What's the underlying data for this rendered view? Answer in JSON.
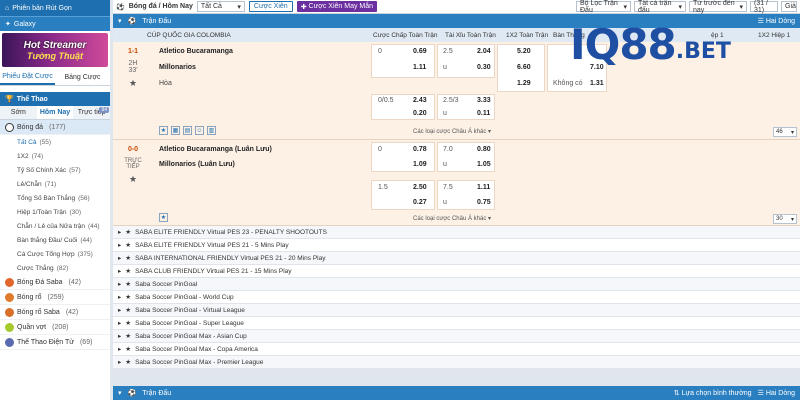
{
  "sidebar": {
    "top_label": "Phiên bản Rút Gọn",
    "galaxy_label": "Galaxy",
    "banner_line1": "Hot Streamer",
    "banner_line2": "Tường Thuật",
    "tab_betslip": "Phiếu Đặt Cược",
    "tab_board": "Bảng Cược",
    "sport_header": "Thể Thao",
    "time_tabs": [
      {
        "label": "Sớm",
        "active": false
      },
      {
        "label": "Hôm Nay",
        "active": true
      },
      {
        "label": "Trực tiếp",
        "active": false,
        "badge": "94"
      }
    ],
    "football": {
      "label": "Bóng đá",
      "count": "(177)"
    },
    "bet_types": [
      {
        "label": "Tất Cả",
        "count": "(55)",
        "active": true
      },
      {
        "label": "1X2",
        "count": "(74)"
      },
      {
        "label": "Tỷ Số Chính Xác",
        "count": "(57)"
      },
      {
        "label": "Lẻ/Chẵn",
        "count": "(71)"
      },
      {
        "label": "Tổng Số Bàn Thắng",
        "count": "(56)"
      },
      {
        "label": "Hiệp 1/Toàn Trận",
        "count": "(30)"
      },
      {
        "label": "Chẵn / Lẻ của Nửa trận",
        "count": "(44)"
      },
      {
        "label": "Bàn thắng Đầu/ Cuối",
        "count": "(44)"
      },
      {
        "label": "Cá Cược Tổng Hợp",
        "count": "(375)"
      },
      {
        "label": "Cược Thắng",
        "count": "(82)"
      }
    ],
    "sports": [
      {
        "label": "Bóng Đá Saba",
        "count": "(42)",
        "color": "#e0662c"
      },
      {
        "label": "Bóng rổ",
        "count": "(259)",
        "color": "#e07a2c"
      },
      {
        "label": "Bóng rổ Saba",
        "count": "(42)",
        "color": "#d9702a"
      },
      {
        "label": "Quần vợt",
        "count": "(208)",
        "color": "#a6c92c"
      },
      {
        "label": "Thể Thao Điện Tử",
        "count": "(69)",
        "color": "#5a6ab0"
      }
    ]
  },
  "toolbar": {
    "breadcrumb": "Bóng đá / Hôm Nay",
    "filter_all": "Tất Cả",
    "combo_button": "Cược Xiên",
    "lucky_combo_button": "Cược Xiên May Mắn",
    "league_filter": "Bộ Lọc Trận Đấu",
    "all_matches": "Tất cả trận đấu",
    "from_time": "Từ trước đến nay",
    "pages": "(31 / 31)",
    "odds_type": "Giả"
  },
  "section": {
    "title": "Trận Đấu",
    "sort": "Lựa chọn bình thường",
    "view": "Hai Dòng",
    "bottom_title": "Trận Đấu"
  },
  "columns": {
    "league": "CÚP QUỐC GIA COLOMBIA",
    "handicap": "Cược Chấp Toàn Trận",
    "over_under": "Tài Xỉu Toàn Trận",
    "x12": "1X2 Toàn Trận",
    "goals": "Bàn Thắng",
    "h1": "ệp 1",
    "x12_h1": "1X2 Hiệp 1"
  },
  "match1": {
    "score": "1-1",
    "period": "2H",
    "minute": "33'",
    "home": "Atletico Bucaramanga",
    "away": "Millonarios",
    "draw": "Hòa",
    "hdp1": "0",
    "hdp1_odds": "0.69",
    "hdp1_away": "1.11",
    "ou1": "2.5",
    "ou1_odds": "2.04",
    "ou1_u": "u",
    "ou1_u_odds": "0.30",
    "x12_home": "5.20",
    "x12_away": "6.60",
    "x12_draw": "1.29",
    "goal_yes_odds": "7.10",
    "goal_no": "Không có",
    "goal_no_odds": "1.31",
    "hdp2": "0/0.5",
    "hdp2_odds": "2.43",
    "hdp2_away": "0.20",
    "ou2": "2.5/3",
    "ou2_odds": "3.33",
    "ou2_u": "u",
    "ou2_u_odds": "0.11",
    "more": "Các loại cược Châu Á khác",
    "count": "46"
  },
  "match2": {
    "score": "0-0",
    "status1": "TRỰC",
    "status2": "TIẾP",
    "home": "Atletico Bucaramanga (Luân Lưu)",
    "away": "Millonarios (Luân Lưu)",
    "hdp1": "0",
    "hdp1_odds": "0.78",
    "hdp1_away": "1.09",
    "ou1": "7.0",
    "ou1_odds": "0.80",
    "ou1_u": "u",
    "ou1_u_odds": "1.05",
    "hdp2": "1.5",
    "hdp2_odds": "2.50",
    "hdp2_away": "0.27",
    "ou2": "7.5",
    "ou2_odds": "1.11",
    "ou2_u": "u",
    "ou2_u_odds": "0.75",
    "more": "Các loại cược Châu Á khác",
    "count": "30"
  },
  "leagues": [
    "SABA ELITE FRIENDLY Virtual PES 23 - PENALTY SHOOTOUTS",
    "SABA ELITE FRIENDLY Virtual PES 21 - 5 Mins Play",
    "SABA INTERNATIONAL FRIENDLY Virtual PES 21 - 20 Mins Play",
    "SABA CLUB FRIENDLY Virtual PES 21 - 15 Mins Play",
    "Saba Soccer PinGoal",
    "Saba Soccer PinGoal - World Cup",
    "Saba Soccer PinGoal - Virtual League",
    "Saba Soccer PinGoal - Super League",
    "Saba Soccer PinGoal Max - Asian Cup",
    "Saba Soccer PinGoal Max - Copa America",
    "Saba Soccer PinGoal Max - Premier League"
  ],
  "watermark": {
    "text": "IQ88",
    "suffix": ".BET"
  }
}
